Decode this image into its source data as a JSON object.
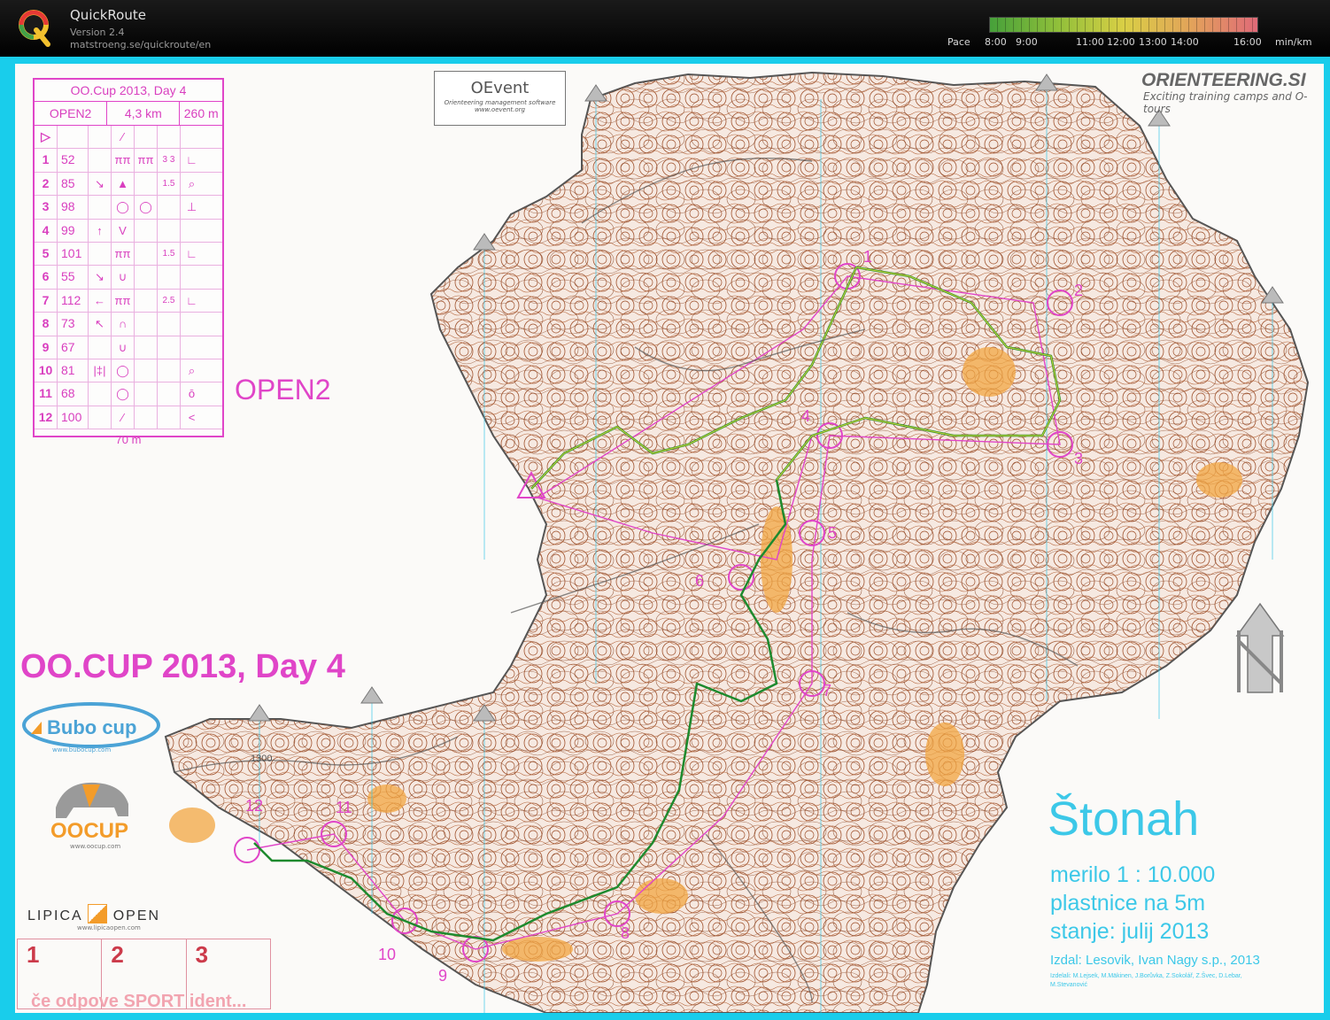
{
  "app": {
    "title": "QuickRoute",
    "version": "Version 2.4",
    "url": "matstroeng.se/quickroute/en"
  },
  "pace_legend": {
    "label": "Pace",
    "ticks": [
      "8:00",
      "9:00",
      "11:00",
      "12:00",
      "13:00",
      "14:00",
      "16:00"
    ],
    "unit": "min/km"
  },
  "control_card": {
    "title": "OO.Cup 2013, Day 4",
    "course": "OPEN2",
    "length": "4,3 km",
    "climb": "260 m",
    "rows": [
      {
        "num": "1",
        "code": "52",
        "c1": "",
        "c2": "ππ",
        "c3": "ππ",
        "c4": "3 3",
        "c5": "∟"
      },
      {
        "num": "2",
        "code": "85",
        "c1": "↘",
        "c2": "▲",
        "c3": "",
        "c4": "1.5",
        "c5": "⌕"
      },
      {
        "num": "3",
        "code": "98",
        "c1": "",
        "c2": "◯",
        "c3": "◯",
        "c4": "",
        "c5": "⊥"
      },
      {
        "num": "4",
        "code": "99",
        "c1": "↑",
        "c2": "V",
        "c3": "",
        "c4": "",
        "c5": ""
      },
      {
        "num": "5",
        "code": "101",
        "c1": "",
        "c2": "ππ",
        "c3": "",
        "c4": "1.5",
        "c5": "∟"
      },
      {
        "num": "6",
        "code": "55",
        "c1": "↘",
        "c2": "∪",
        "c3": "",
        "c4": "",
        "c5": ""
      },
      {
        "num": "7",
        "code": "112",
        "c1": "←",
        "c2": "ππ",
        "c3": "",
        "c4": "2.5",
        "c5": "∟"
      },
      {
        "num": "8",
        "code": "73",
        "c1": "↖",
        "c2": "∩",
        "c3": "",
        "c4": "",
        "c5": ""
      },
      {
        "num": "9",
        "code": "67",
        "c1": "",
        "c2": "∪",
        "c3": "",
        "c4": "",
        "c5": ""
      },
      {
        "num": "10",
        "code": "81",
        "c1": "|‡|",
        "c2": "◯",
        "c3": "",
        "c4": "",
        "c5": "⌕"
      },
      {
        "num": "11",
        "code": "68",
        "c1": "",
        "c2": "◯",
        "c3": "",
        "c4": "",
        "c5": "ō"
      },
      {
        "num": "12",
        "code": "100",
        "c1": "",
        "c2": "⁄",
        "c3": "",
        "c4": "",
        "c5": "<"
      }
    ],
    "finish_distance": "70 m"
  },
  "course_label": "OPEN2",
  "event_title": "OO.CUP 2013, Day 4",
  "oevent": {
    "title": "OEvent",
    "subtitle": "Orienteering management software",
    "url": "www.oevent.org"
  },
  "orienteering_si": {
    "title": "ORIENTEERING.SI",
    "subtitle": "Exciting training camps and O-tours"
  },
  "sponsors": {
    "bubo": "Bubo cup",
    "bubo_url": "www.bubocup.com",
    "oocup": "OOCUP",
    "oocup_url": "www.oocup.com",
    "lipica_left": "LIPICA",
    "lipica_right": "OPEN",
    "lipica_url": "www.lipicaopen.com"
  },
  "punch_box": {
    "numbers": [
      "1",
      "2",
      "3"
    ],
    "note": "če odpove SPORT ident..."
  },
  "map_info": {
    "name": "Štonah",
    "scale": "merilo 1 : 10.000",
    "contours": "plastnice na 5m",
    "updated": "stanje: julij 2013",
    "publisher": "Izdal: Lesovik, Ivan Nagy s.p., 2013",
    "credits": "Izdelali: M.Lejsek, M.Mäkinen, J.Borůvka, Z.Sokolář, Z.Švec, D.Lebar, M.Stevanović"
  },
  "map_labels": {
    "elevation": "1300",
    "controls": [
      "1",
      "2",
      "3",
      "4",
      "5",
      "6",
      "7",
      "8",
      "9",
      "10",
      "11",
      "12"
    ]
  },
  "colors": {
    "frame": "#19cdeb",
    "course": "#e045c8",
    "route": "#1e8a2e",
    "contour": "#a0522d",
    "rough": "#f2a541"
  }
}
